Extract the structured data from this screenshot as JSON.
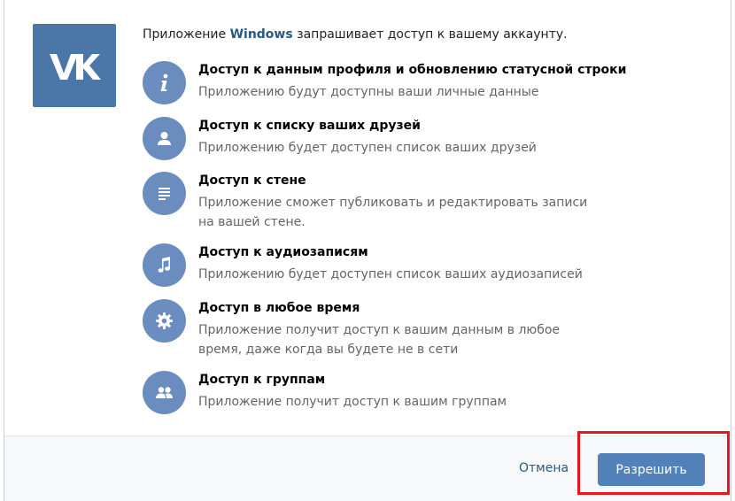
{
  "colors": {
    "brand": "#4a76a8",
    "icon_circle": "#6b8cbf",
    "link": "#2a5885",
    "primary_button": "#5181b8",
    "highlight": "#e8161c"
  },
  "header": {
    "logo_icon": "vk-logo-icon",
    "intro_prefix": "Приложение ",
    "app_name": "Windows",
    "intro_suffix": " запрашивает доступ к вашему аккаунту."
  },
  "permissions": [
    {
      "icon": "info-icon",
      "title": "Доступ к данным профиля и обновлению статусной строки",
      "description": "Приложению будут доступны ваши личные данные"
    },
    {
      "icon": "user-icon",
      "title": "Доступ к списку ваших друзей",
      "description": "Приложению будет доступен список ваших друзей"
    },
    {
      "icon": "wall-icon",
      "title": "Доступ к стене",
      "description": "Приложение сможет публиковать и редактировать записи на вашей стене."
    },
    {
      "icon": "music-icon",
      "title": "Доступ к аудиозаписям",
      "description": "Приложению будет доступен список ваших аудиозаписей"
    },
    {
      "icon": "gear-icon",
      "title": "Доступ в любое время",
      "description": "Приложение получит доступ к вашим данным в любое время, даже когда вы будете не в сети"
    },
    {
      "icon": "groups-icon",
      "title": "Доступ к группам",
      "description": "Приложение получит доступ к вашим группам"
    }
  ],
  "footer": {
    "cancel_label": "Отмена",
    "allow_label": "Разрешить"
  }
}
